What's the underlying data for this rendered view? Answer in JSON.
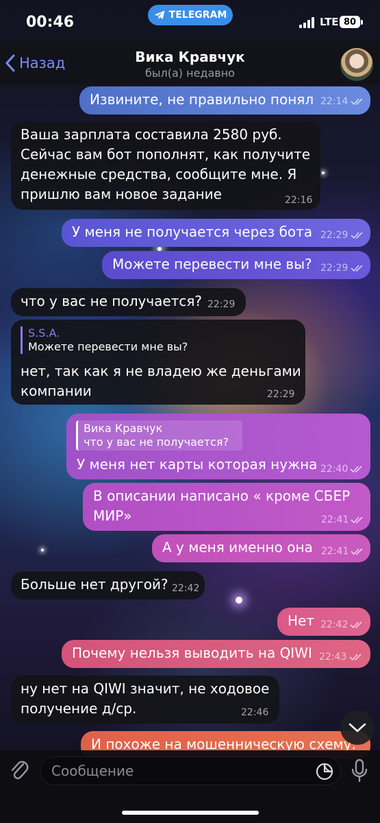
{
  "status_bar": {
    "time": "00:46",
    "app_pill": "TELEGRAM",
    "network": "LTE",
    "battery": "80"
  },
  "header": {
    "back_label": "Назад",
    "contact_name": "Вика Кравчук",
    "contact_status": "был(а) недавно"
  },
  "messages": [
    {
      "dir": "out",
      "text": "Извините, не правильно понял",
      "time": "22:14",
      "read": true
    },
    {
      "dir": "in",
      "text": "Ваша зарплата составила 2580 руб.\nСейчас вам бот пополнят, как получите\nденежные средства, сообщите мне. Я\nпришлю вам новое задание",
      "time": "22:16"
    },
    {
      "dir": "out",
      "text": "У меня не получается через бота",
      "time": "22:29",
      "read": true
    },
    {
      "dir": "out",
      "text": "Можете перевести мне вы?",
      "time": "22:29",
      "read": true
    },
    {
      "dir": "in",
      "text": "что у вас не получается?",
      "time": "22:29"
    },
    {
      "dir": "in",
      "reply_name": "S.S.A.",
      "reply_text": "Можете перевести мне вы?",
      "text": "нет, так как я не владею же деньгами\nкомпании",
      "time": "22:29"
    },
    {
      "dir": "out",
      "reply_name": "Вика Кравчук",
      "reply_text": "что у вас не получается?",
      "text": "У меня нет карты которая нужна",
      "time": "22:40",
      "read": true
    },
    {
      "dir": "out",
      "text": "В описании написано « кроме СБЕР\nМИР»",
      "time": "22:41",
      "read": true
    },
    {
      "dir": "out",
      "text": "А у меня именно она",
      "time": "22:41",
      "read": true
    },
    {
      "dir": "in",
      "text": "Больше нет другой?",
      "time": "22:42"
    },
    {
      "dir": "out",
      "text": "Нет",
      "time": "22:42",
      "read": true
    },
    {
      "dir": "out",
      "text": "Почему нельзя выводить на QIWI",
      "time": "22:43",
      "read": true
    },
    {
      "dir": "in",
      "text": "ну нет на QIWI значит, не ходовое\nполучение д/ср.",
      "time": "22:46"
    },
    {
      "dir": "out",
      "text": "И похоже на мошенническую схему.",
      "time": "",
      "read": false
    }
  ],
  "input": {
    "placeholder": "Сообщение"
  },
  "colors": {
    "accent": "#7b8cff",
    "incoming": "#141418",
    "reply_in": "#8c7cf0",
    "telegram_pill": "#3a8ee8"
  },
  "icons": [
    "chevron-left-icon",
    "telegram-icon",
    "signal-icon",
    "paperclip-icon",
    "sticker-icon",
    "microphone-icon",
    "chevron-down-icon",
    "double-check-icon"
  ]
}
